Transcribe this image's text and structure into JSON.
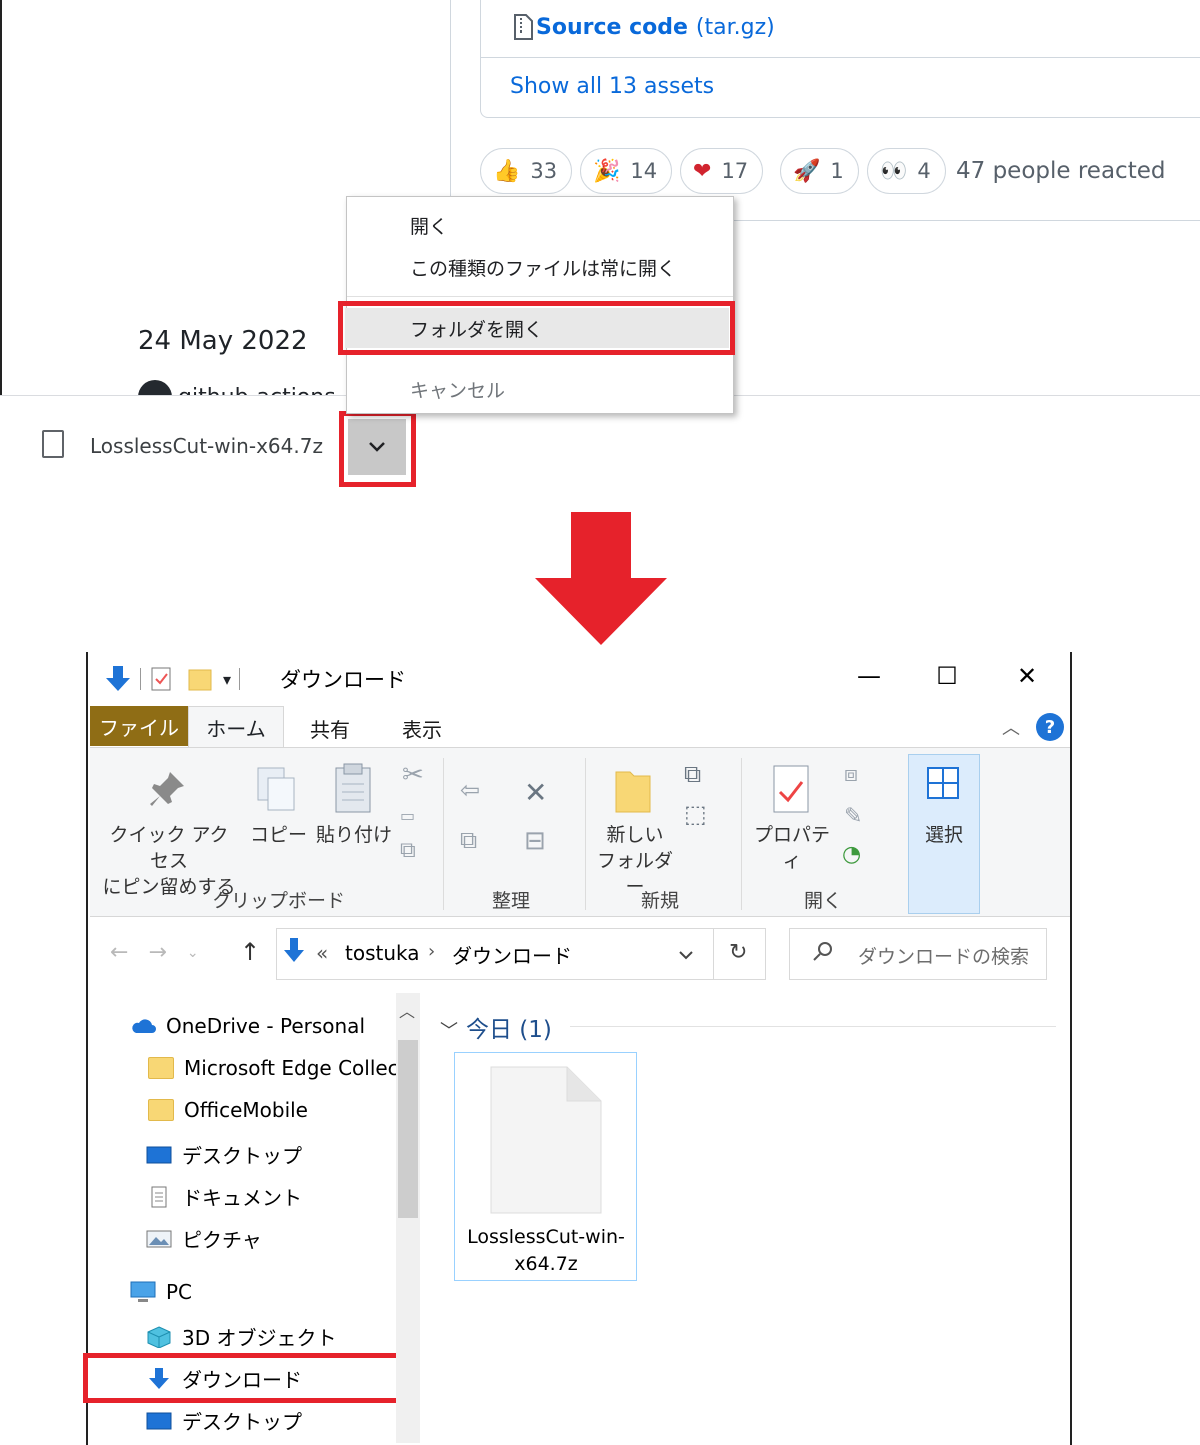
{
  "browser": {
    "assets": {
      "source_code_bold": "Source code",
      "source_code_light": "(tar.gz)",
      "show_all": "Show all 13 assets"
    },
    "reactions": [
      {
        "icon": "thumbs-up",
        "emoji": "👍",
        "count": "33"
      },
      {
        "icon": "party-popper",
        "emoji": "🎉",
        "count": "14"
      },
      {
        "icon": "heart",
        "emoji": "❤",
        "count": "17"
      },
      {
        "icon": "rocket",
        "emoji": "🚀",
        "count": "1"
      },
      {
        "icon": "eyes",
        "emoji": "👀",
        "count": "4"
      }
    ],
    "reactions_summary": "47 people reacted",
    "release_date": "24 May 2022",
    "author": "github-actions",
    "context_menu": {
      "open": "開く",
      "always_open": "この種類のファイルは常に開く",
      "show_in_folder": "フォルダを開く",
      "cancel": "キャンセル"
    },
    "download": {
      "file_name": "LosslessCut-win-x64.7z",
      "chevron": "⌄"
    }
  },
  "highlight_color": "#e6222b",
  "explorer": {
    "title": "ダウンロード",
    "window_buttons": {
      "minimize": "—",
      "maximize": "☐",
      "close": "✕"
    },
    "tabs": {
      "file": "ファイル",
      "home": "ホーム",
      "share": "共有",
      "view": "表示"
    },
    "help": "?",
    "ribbon": {
      "pin_line1": "クイック アクセス",
      "pin_line2": "にピン留めする",
      "copy": "コピー",
      "paste": "貼り付け",
      "new_folder_line1": "新しい",
      "new_folder_line2": "フォルダー",
      "properties": "プロパティ",
      "select": "選択",
      "groups": {
        "clipboard": "クリップボード",
        "organize": "整理",
        "new": "新規",
        "open": "開く"
      }
    },
    "address": {
      "chevron": "«",
      "user": "tostuka",
      "sep": "›",
      "folder": "ダウンロード"
    },
    "search_placeholder": "ダウンロードの検索",
    "nav": [
      {
        "label": "OneDrive - Personal",
        "icon": "onedrive-cloud"
      },
      {
        "label": "Microsoft Edge Collect",
        "icon": "folder"
      },
      {
        "label": "OfficeMobile",
        "icon": "folder"
      },
      {
        "label": "デスクトップ",
        "icon": "desktop"
      },
      {
        "label": "ドキュメント",
        "icon": "document"
      },
      {
        "label": "ピクチャ",
        "icon": "pictures"
      },
      {
        "label": "PC",
        "icon": "pc"
      },
      {
        "label": "3D オブジェクト",
        "icon": "3d-object"
      },
      {
        "label": "ダウンロード",
        "icon": "download"
      },
      {
        "label": "デスクトップ",
        "icon": "desktop"
      }
    ],
    "group_header": "今日 (1)",
    "file": {
      "name_line1": "LosslessCut-win-",
      "name_line2": "x64.7z"
    }
  }
}
